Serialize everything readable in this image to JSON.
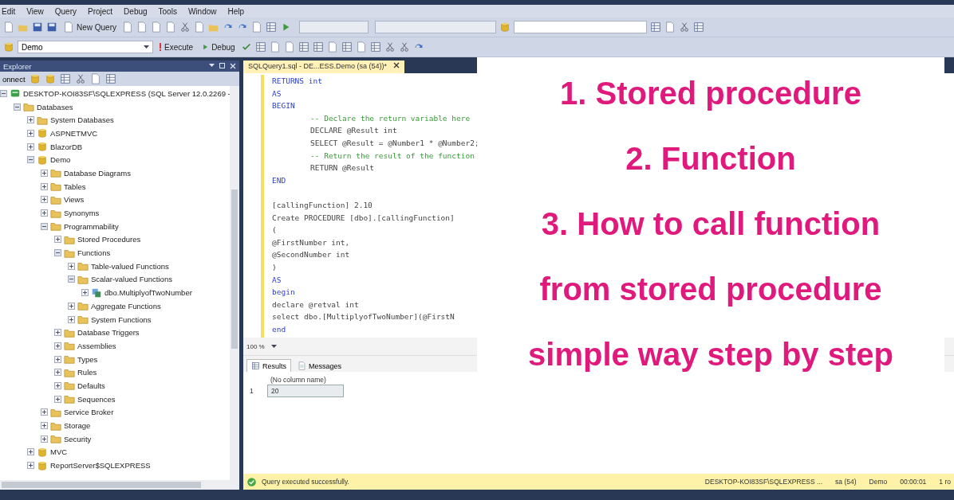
{
  "menu": [
    "Edit",
    "View",
    "Query",
    "Project",
    "Debug",
    "Tools",
    "Window",
    "Help"
  ],
  "toolbar": {
    "new_query": "New Query",
    "database": "Demo",
    "execute": "Execute",
    "debug": "Debug"
  },
  "explorer": {
    "title": "Explorer",
    "connect": "onnect",
    "tree": [
      {
        "label": "DESKTOP-KOI83SF\\SQLEXPRESS (SQL Server 12.0.2269 -",
        "kind": "server",
        "expanded": true,
        "children": [
          {
            "label": "Databases",
            "kind": "folder",
            "expanded": true,
            "children": [
              {
                "label": "System Databases",
                "kind": "folder",
                "expanded": false
              },
              {
                "label": "ASPNETMVC",
                "kind": "database",
                "expanded": false
              },
              {
                "label": "BlazorDB",
                "kind": "database",
                "expanded": false
              },
              {
                "label": "Demo",
                "kind": "database",
                "expanded": true,
                "children": [
                  {
                    "label": "Database Diagrams",
                    "kind": "folder",
                    "expanded": false
                  },
                  {
                    "label": "Tables",
                    "kind": "folder",
                    "expanded": false
                  },
                  {
                    "label": "Views",
                    "kind": "folder",
                    "expanded": false
                  },
                  {
                    "label": "Synonyms",
                    "kind": "folder",
                    "expanded": false
                  },
                  {
                    "label": "Programmability",
                    "kind": "folder",
                    "expanded": true,
                    "children": [
                      {
                        "label": "Stored Procedures",
                        "kind": "folder",
                        "expanded": false
                      },
                      {
                        "label": "Functions",
                        "kind": "folder",
                        "expanded": true,
                        "children": [
                          {
                            "label": "Table-valued Functions",
                            "kind": "folder",
                            "expanded": false
                          },
                          {
                            "label": "Scalar-valued Functions",
                            "kind": "folder",
                            "expanded": true,
                            "children": [
                              {
                                "label": "dbo.MultiplyofTwoNumber",
                                "kind": "function",
                                "expanded": false
                              }
                            ]
                          },
                          {
                            "label": "Aggregate Functions",
                            "kind": "folder",
                            "expanded": false
                          },
                          {
                            "label": "System Functions",
                            "kind": "folder",
                            "expanded": false
                          }
                        ]
                      },
                      {
                        "label": "Database Triggers",
                        "kind": "folder",
                        "expanded": false
                      },
                      {
                        "label": "Assemblies",
                        "kind": "folder",
                        "expanded": false
                      },
                      {
                        "label": "Types",
                        "kind": "folder",
                        "expanded": false
                      },
                      {
                        "label": "Rules",
                        "kind": "folder",
                        "expanded": false
                      },
                      {
                        "label": "Defaults",
                        "kind": "folder",
                        "expanded": false
                      },
                      {
                        "label": "Sequences",
                        "kind": "folder",
                        "expanded": false
                      }
                    ]
                  },
                  {
                    "label": "Service Broker",
                    "kind": "folder",
                    "expanded": false
                  },
                  {
                    "label": "Storage",
                    "kind": "folder",
                    "expanded": false
                  },
                  {
                    "label": "Security",
                    "kind": "folder",
                    "expanded": false
                  }
                ]
              },
              {
                "label": "MVC",
                "kind": "database",
                "expanded": false
              },
              {
                "label": "ReportServer$SQLEXPRESS",
                "kind": "database",
                "expanded": false
              }
            ]
          }
        ]
      }
    ]
  },
  "editor": {
    "tab": "SQLQuery1.sql - DE...ESS.Demo (sa (54))*",
    "lines": [
      {
        "text": "RETURNS int",
        "kind": "keyword",
        "indented": false
      },
      {
        "text": "AS",
        "kind": "keyword",
        "indented": false
      },
      {
        "text": "BEGIN",
        "kind": "keyword",
        "indented": false
      },
      {
        "text": "-- Declare the return variable here",
        "kind": "comment",
        "indented": true
      },
      {
        "text": "DECLARE @Result int",
        "kind": "code",
        "indented": true
      },
      {
        "text": "SELECT @Result = @Number1 * @Number2;",
        "kind": "code",
        "indented": true
      },
      {
        "text": "-- Return the result of the function",
        "kind": "comment",
        "indented": true
      },
      {
        "text": "RETURN @Result",
        "kind": "code",
        "indented": true
      },
      {
        "text": "END",
        "kind": "keyword",
        "indented": false
      },
      {
        "kind": "blank"
      },
      {
        "text": "[callingFunction] 2.10",
        "kind": "code",
        "indented": false
      },
      {
        "text": "Create PROCEDURE [dbo].[callingFunction]",
        "kind": "code",
        "indented": false
      },
      {
        "text": "(",
        "kind": "code",
        "indented": false
      },
      {
        "text": "@FirstNumber int,",
        "kind": "code",
        "indented": false
      },
      {
        "text": "@SecondNumber int",
        "kind": "code",
        "indented": false
      },
      {
        "text": ")",
        "kind": "code",
        "indented": false
      },
      {
        "text": "AS",
        "kind": "keyword",
        "indented": false
      },
      {
        "text": "begin",
        "kind": "keyword",
        "indented": false
      },
      {
        "text": "declare @retval int",
        "kind": "code",
        "indented": false
      },
      {
        "text": "select dbo.[MultiplyofTwoNumber](@FirstN",
        "kind": "code",
        "indented": false
      },
      {
        "text": "end",
        "kind": "keyword",
        "indented": false
      }
    ],
    "zoom": "100 %"
  },
  "results": {
    "tabs": [
      {
        "label": "Results",
        "selected": true
      },
      {
        "label": "Messages",
        "selected": false
      }
    ],
    "column": "(No column name)",
    "rows": [
      {
        "number": "1",
        "value": "20"
      }
    ]
  },
  "status": {
    "message": "Query executed successfully.",
    "server": "DESKTOP-KOI83SF\\SQLEXPRESS ...",
    "user": "sa (54)",
    "database": "Demo",
    "time": "00:00:01",
    "rows": "1 ro"
  },
  "overlay": {
    "lines": [
      "1. Stored procedure",
      "2. Function",
      "3. How to call function",
      "from stored procedure",
      "simple way step by step"
    ]
  }
}
